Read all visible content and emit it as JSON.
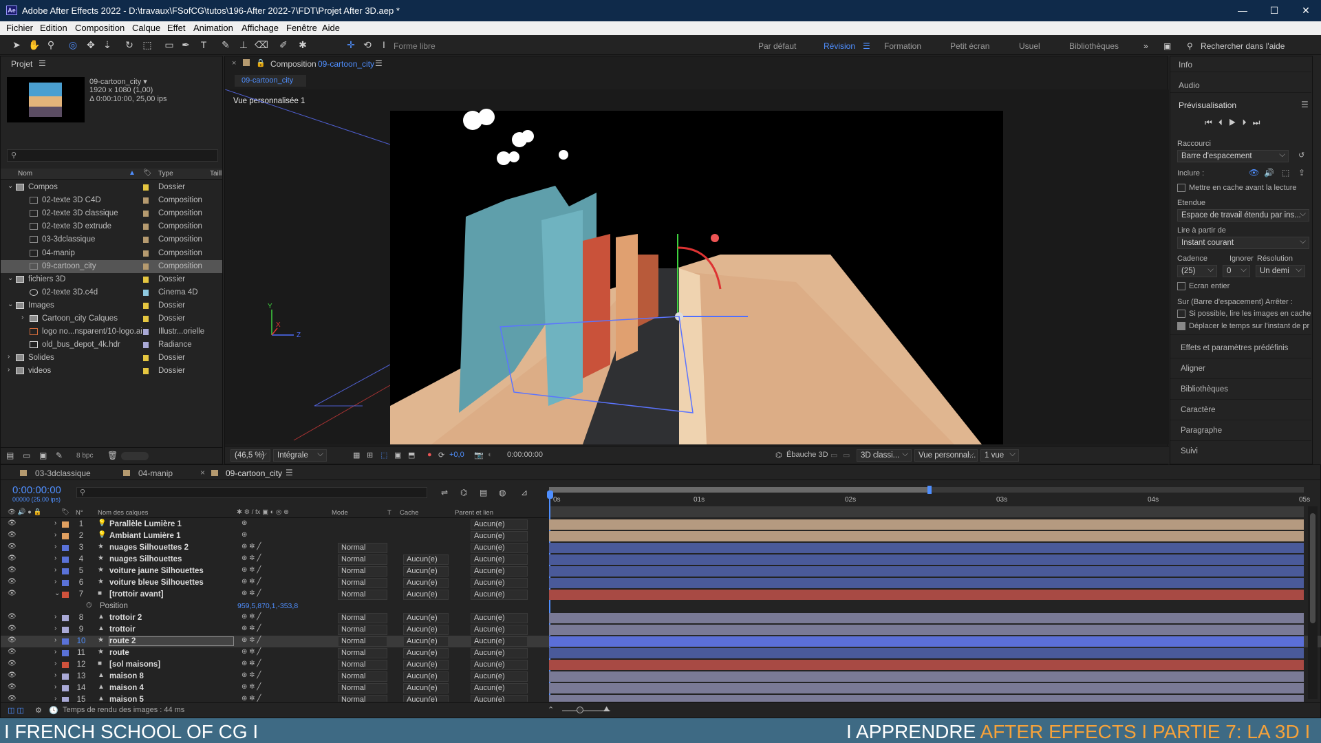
{
  "window": {
    "title": "Adobe After Effects 2022 - D:\\travaux\\FSofCG\\tutos\\196-After 2022-7\\FDT\\Projet After 3D.aep *",
    "logo": "Ae",
    "minimize": "—",
    "maximize": "☐",
    "close": "✕"
  },
  "menu": [
    "Fichier",
    "Edition",
    "Composition",
    "Calque",
    "Effet",
    "Animation",
    "Affichage",
    "Fenêtre",
    "Aide"
  ],
  "toolbar": {
    "forme_libre": "Forme libre",
    "workspaces": [
      "Par défaut",
      "Révision",
      "Formation",
      "Petit écran",
      "Usuel",
      "Bibliothèques"
    ],
    "active_workspace": "Révision",
    "search_placeholder": "Rechercher dans l'aide"
  },
  "project": {
    "title": "Projet",
    "comp_name": "09-cartoon_city ▾",
    "comp_info1": "1920 x 1080 (1,00)",
    "comp_info2": "Δ 0:00:10:00, 25,00 ips",
    "search_placeholder": "",
    "col_name": "Nom",
    "col_type": "Type",
    "col_size": "Taill",
    "items": [
      {
        "name": "Compos",
        "type": "Dossier",
        "indent": 0,
        "icon": "folder",
        "twirl": "⌄",
        "color": "#e5c640"
      },
      {
        "name": "02-texte 3D C4D",
        "type": "Composition",
        "indent": 1,
        "icon": "comp",
        "color": "#b59a6f"
      },
      {
        "name": "02-texte 3D classique",
        "type": "Composition",
        "indent": 1,
        "icon": "comp",
        "color": "#b59a6f"
      },
      {
        "name": "02-texte 3D extrude",
        "type": "Composition",
        "indent": 1,
        "icon": "comp",
        "color": "#b59a6f"
      },
      {
        "name": "03-3dclassique",
        "type": "Composition",
        "indent": 1,
        "icon": "comp",
        "color": "#b59a6f"
      },
      {
        "name": "04-manip",
        "type": "Composition",
        "indent": 1,
        "icon": "comp",
        "color": "#b59a6f"
      },
      {
        "name": "09-cartoon_city",
        "type": "Composition",
        "indent": 1,
        "icon": "comp",
        "color": "#b59a6f",
        "selected": true
      },
      {
        "name": "fichiers 3D",
        "type": "Dossier",
        "indent": 0,
        "icon": "folder",
        "twirl": "⌄",
        "color": "#e5c640"
      },
      {
        "name": "02-texte 3D.c4d",
        "type": "Cinema 4D",
        "indent": 1,
        "icon": "c4d",
        "color": "#8ec9e0"
      },
      {
        "name": "Images",
        "type": "Dossier",
        "indent": 0,
        "icon": "folder",
        "twirl": "⌄",
        "color": "#e5c640"
      },
      {
        "name": "Cartoon_city Calques",
        "type": "Dossier",
        "indent": 1,
        "icon": "folder",
        "twirl": "›",
        "color": "#e5c640"
      },
      {
        "name": "logo no...nsparent/10-logo.ai",
        "type": "Illustr...orielle",
        "indent": 1,
        "icon": "ai",
        "color": "#a9a9d6"
      },
      {
        "name": "old_bus_depot_4k.hdr",
        "type": "Radiance",
        "indent": 1,
        "icon": "file",
        "color": "#a9a9d6"
      },
      {
        "name": "Solides",
        "type": "Dossier",
        "indent": 0,
        "icon": "folder",
        "twirl": "›",
        "color": "#e5c640"
      },
      {
        "name": "videos",
        "type": "Dossier",
        "indent": 0,
        "icon": "folder",
        "twirl": "›",
        "color": "#e5c640"
      }
    ],
    "bpc": "8 bpc"
  },
  "composition": {
    "panel_label": "Composition",
    "comp_name": "09-cartoon_city",
    "tab": "09-cartoon_city",
    "view_label": "Vue personnalisée 1",
    "bottom": {
      "zoom": "(46,5 %)",
      "resolution": "Intégrale",
      "exposure": "+0,0",
      "timecode": "0:00:00:00",
      "draft": "Ébauche 3D",
      "renderer": "3D classi...",
      "view": "Vue personnal...",
      "views": "1 vue"
    }
  },
  "right": {
    "info": "Info",
    "audio": "Audio",
    "preview": "Prévisualisation",
    "raccourci": "Raccourci",
    "raccourci_val": "Barre d'espacement",
    "inclure": "Inclure :",
    "cache_label": "Mettre en cache avant la lecture",
    "etendue": "Etendue",
    "etendue_val": "Espace de travail étendu par ins...",
    "lire": "Lire à partir de",
    "lire_val": "Instant courant",
    "cadence": "Cadence",
    "ignorer": "Ignorer",
    "resolution": "Résolution",
    "cadence_val": "(25)",
    "ignorer_val": "0",
    "res_val": "Un demi",
    "ecran": "Ecran entier",
    "sur": "Sur (Barre d'espacement) Arrêter :",
    "opt1": "Si possible, lire les images en cache",
    "opt2": "Déplacer le temps sur l'instant de pr",
    "panels": [
      "Effets et paramètres prédéfinis",
      "Aligner",
      "Bibliothèques",
      "Caractère",
      "Paragraphe",
      "Suivi"
    ]
  },
  "timeline": {
    "tabs": [
      "03-3dclassique",
      "04-manip",
      "09-cartoon_city"
    ],
    "timecode": "0:00:00:00",
    "frames": "00000 (25.00 ips)",
    "col_num": "N°",
    "col_name": "Nom des calques",
    "col_mode": "Mode",
    "col_t": "T",
    "col_cache": "Cache",
    "col_parent": "Parent et lien",
    "ruler": [
      "0s",
      "01s",
      "02s",
      "03s",
      "04s",
      "05s"
    ],
    "render_time": "Temps de rendu des images : 44 ms",
    "layers": [
      {
        "n": "1",
        "name": "Parallèle Lumière 1",
        "label": "#e0a060",
        "icon": "light",
        "mode": "",
        "cache": "",
        "parent": "Aucun(e)",
        "bar": "#b59a80"
      },
      {
        "n": "2",
        "name": "Ambiant Lumière 1",
        "label": "#e0a060",
        "icon": "light",
        "mode": "",
        "cache": "",
        "parent": "Aucun(e)",
        "bar": "#b59a80"
      },
      {
        "n": "3",
        "name": "nuages Silhouettes 2",
        "label": "#5a72d8",
        "icon": "star",
        "mode": "Normal",
        "cache": "",
        "parent": "Aucun(e)",
        "bar": "#4a5a9a"
      },
      {
        "n": "4",
        "name": "nuages Silhouettes",
        "label": "#5a72d8",
        "icon": "star",
        "mode": "Normal",
        "cache": "Aucun(e)",
        "parent": "Aucun(e)",
        "bar": "#4a5a9a"
      },
      {
        "n": "5",
        "name": "voiture jaune Silhouettes",
        "label": "#5a72d8",
        "icon": "star",
        "mode": "Normal",
        "cache": "Aucun(e)",
        "parent": "Aucun(e)",
        "bar": "#4a5a9a"
      },
      {
        "n": "6",
        "name": "voiture bleue Silhouettes",
        "label": "#5a72d8",
        "icon": "star",
        "mode": "Normal",
        "cache": "Aucun(e)",
        "parent": "Aucun(e)",
        "bar": "#4a5a9a"
      },
      {
        "n": "7",
        "name": "[trottoir avant]",
        "label": "#d0523c",
        "icon": "solid",
        "mode": "Normal",
        "cache": "Aucun(e)",
        "parent": "Aucun(e)",
        "bar": "#a84a44",
        "expanded": true
      },
      {
        "n": "8",
        "name": "trottoir 2",
        "label": "#a9a9d6",
        "icon": "ai",
        "mode": "Normal",
        "cache": "Aucun(e)",
        "parent": "Aucun(e)",
        "bar": "#7a7a96"
      },
      {
        "n": "9",
        "name": "trottoir",
        "label": "#a9a9d6",
        "icon": "ai",
        "mode": "Normal",
        "cache": "Aucun(e)",
        "parent": "Aucun(e)",
        "bar": "#7a7a96"
      },
      {
        "n": "10",
        "name": "route 2",
        "label": "#5a72d8",
        "icon": "star",
        "mode": "Normal",
        "cache": "Aucun(e)",
        "parent": "Aucun(e)",
        "bar": "#5b6fd8",
        "selected": true
      },
      {
        "n": "11",
        "name": "route",
        "label": "#5a72d8",
        "icon": "star",
        "mode": "Normal",
        "cache": "Aucun(e)",
        "parent": "Aucun(e)",
        "bar": "#4a5a9a"
      },
      {
        "n": "12",
        "name": "[sol maisons]",
        "label": "#d0523c",
        "icon": "solid",
        "mode": "Normal",
        "cache": "Aucun(e)",
        "parent": "Aucun(e)",
        "bar": "#a84a44"
      },
      {
        "n": "13",
        "name": "maison 8",
        "label": "#a9a9d6",
        "icon": "ai",
        "mode": "Normal",
        "cache": "Aucun(e)",
        "parent": "Aucun(e)",
        "bar": "#7a7a96"
      },
      {
        "n": "14",
        "name": "maison 4",
        "label": "#a9a9d6",
        "icon": "ai",
        "mode": "Normal",
        "cache": "Aucun(e)",
        "parent": "Aucun(e)",
        "bar": "#7a7a96"
      },
      {
        "n": "15",
        "name": "maison 5",
        "label": "#a9a9d6",
        "icon": "ai",
        "mode": "Normal",
        "cache": "Aucun(e)",
        "parent": "Aucun(e)",
        "bar": "#7a7a96"
      }
    ],
    "prop_name": "Position",
    "prop_value": "959,5,870,1,-353,8"
  },
  "footer": {
    "left": "I FRENCH SCHOOL OF CG I",
    "right_a": "I APPRENDRE ",
    "right_b": "AFTER EFFECTS",
    "right_c": " I PARTIE 7: LA 3D I"
  }
}
